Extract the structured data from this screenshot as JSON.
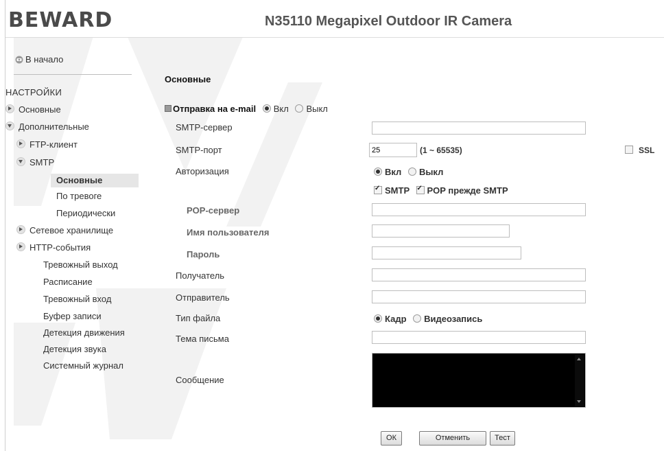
{
  "header": {
    "logo": "BEWARD",
    "title": "N35110 Megapixel Outdoor IR Camera"
  },
  "sidebar": {
    "home": "В начало",
    "section": "НАСТРОЙКИ",
    "items": [
      {
        "label": "Основные"
      },
      {
        "label": "Дополнительные"
      },
      {
        "label": "FTP-клиент"
      },
      {
        "label": "SMTP"
      },
      {
        "label": "Основные"
      },
      {
        "label": "По тревоге"
      },
      {
        "label": "Периодически"
      },
      {
        "label": "Сетевое хранилище"
      },
      {
        "label": "HTTP-события"
      },
      {
        "label": "Тревожный выход"
      },
      {
        "label": "Расписание"
      },
      {
        "label": "Тревожный вход"
      },
      {
        "label": "Буфер записи"
      },
      {
        "label": "Детекция движения"
      },
      {
        "label": "Детекция звука"
      },
      {
        "label": "Системный журнал"
      }
    ]
  },
  "main": {
    "section_title": "Основные",
    "email_label": "Отправка на e-mail",
    "on": "Вкл",
    "off": "Выкл",
    "smtp_server": {
      "label": "SMTP-сервер",
      "value": ""
    },
    "smtp_port": {
      "label": "SMTP-порт",
      "value": "25",
      "range": "(1 ~ 65535)"
    },
    "ssl": "SSL",
    "auth": {
      "label": "Авторизация",
      "on": "Вкл",
      "off": "Выкл"
    },
    "auth_smtp": "SMTP",
    "auth_pop": "POP прежде SMTP",
    "pop_server": {
      "label": "POP-сервер",
      "value": ""
    },
    "username": {
      "label": "Имя пользователя",
      "value": ""
    },
    "password": {
      "label": "Пароль",
      "value": ""
    },
    "recipient": {
      "label": "Получатель",
      "value": ""
    },
    "sender": {
      "label": "Отправитель",
      "value": ""
    },
    "file_type": {
      "label": "Тип файла",
      "frame": "Кадр",
      "video": "Видеозапись"
    },
    "subject": {
      "label": "Тема письма",
      "value": ""
    },
    "message": {
      "label": "Сообщение",
      "value": ""
    },
    "buttons": {
      "ok": "ОК",
      "cancel": "Отменить",
      "test": "Тест"
    }
  }
}
